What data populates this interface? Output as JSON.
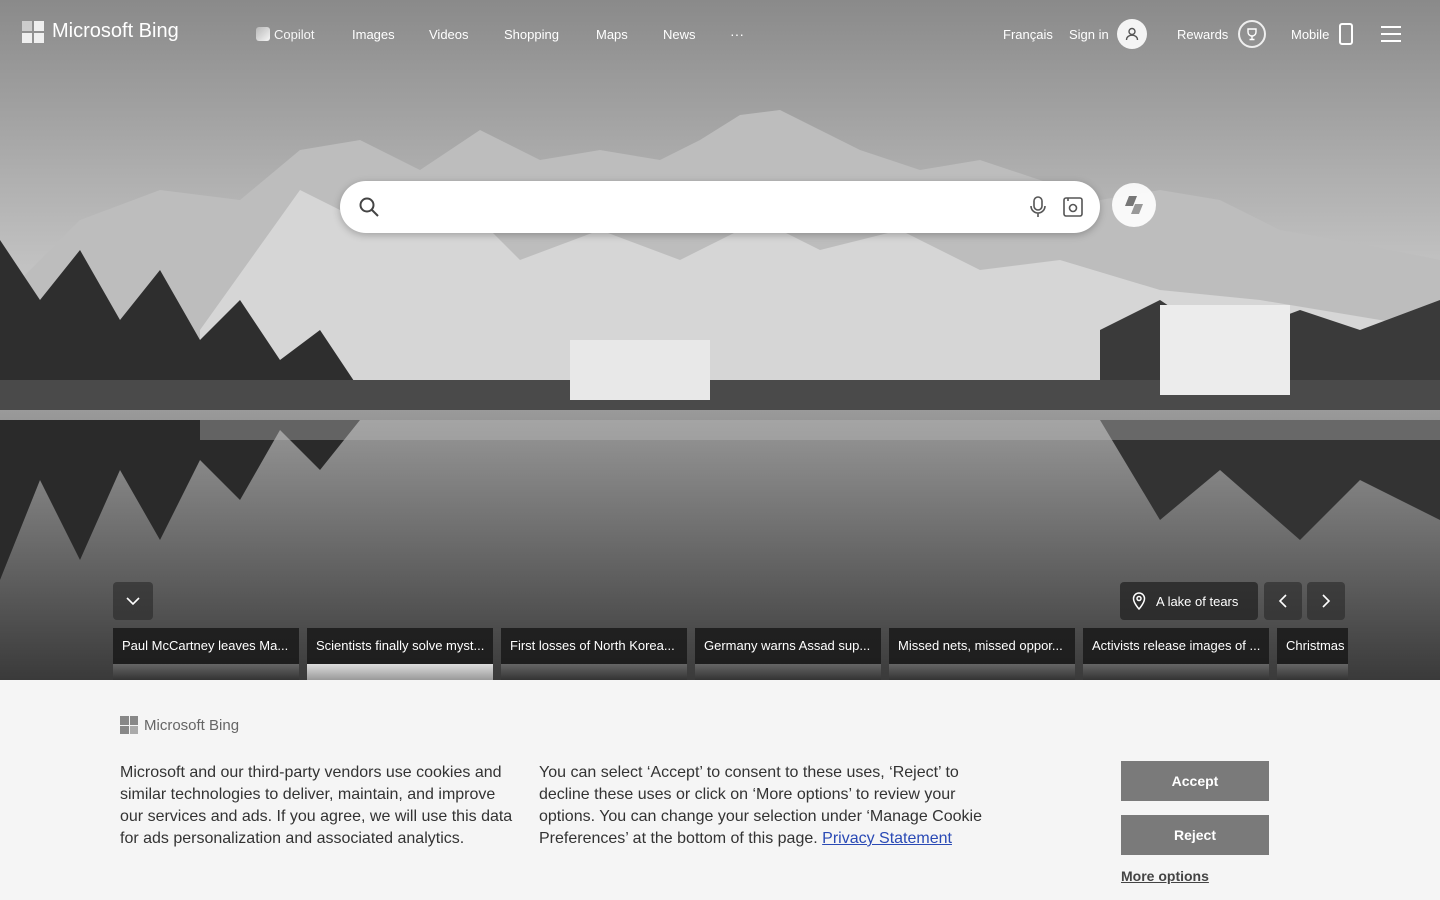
{
  "header": {
    "logo_text": "Microsoft Bing",
    "nav": [
      {
        "label": "Copilot",
        "icon": "copilot-icon"
      },
      {
        "label": "Images"
      },
      {
        "label": "Videos"
      },
      {
        "label": "Shopping"
      },
      {
        "label": "Maps"
      },
      {
        "label": "News"
      },
      {
        "label": "···"
      }
    ],
    "language": "Français",
    "sign_in": "Sign in",
    "rewards": "Rewards",
    "mobile": "Mobile"
  },
  "search": {
    "placeholder": "",
    "value": ""
  },
  "carousel": {
    "location_label": "A lake of tears",
    "cards": [
      "Paul McCartney leaves Ma...",
      "Scientists finally solve myst...",
      "First losses of North Korea...",
      "Germany warns Assad sup...",
      "Missed nets, missed oppor...",
      "Activists release images of ...",
      "Christmas c"
    ]
  },
  "cookie_banner": {
    "brand": "Microsoft Bing",
    "paragraph1": "Microsoft and our third-party vendors use cookies and similar technologies to deliver, maintain, and improve our services and ads. If you agree, we will use this data for ads personalization and associated analytics.",
    "paragraph2": "You can select ‘Accept’ to consent to these uses, ‘Reject’ to decline these uses or click on ‘More options’ to review your options. You can change your selection under ‘Manage Cookie Preferences’ at the bottom of this page.",
    "privacy_link": "Privacy Statement",
    "accept": "Accept",
    "reject": "Reject",
    "more_options": "More options"
  },
  "colors": {
    "cookie_bg": "#f5f5f5",
    "button_gray": "#7a7a7a",
    "link": "#2a4ab5"
  }
}
